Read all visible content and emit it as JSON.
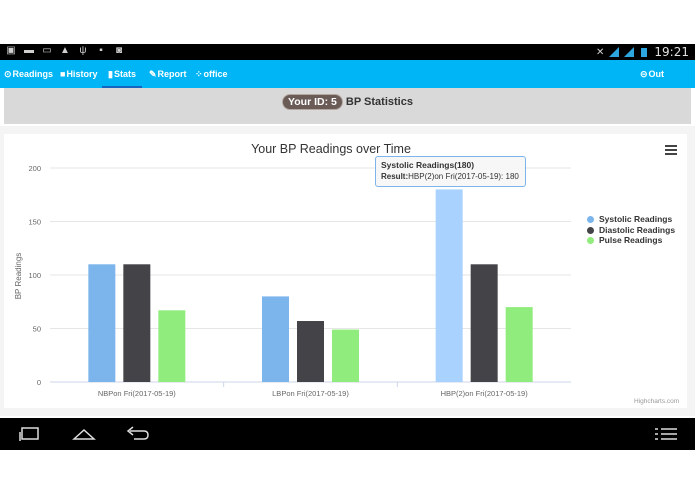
{
  "status": {
    "time": "19:21"
  },
  "nav": {
    "readings": "Readings",
    "history": "History",
    "stats": "Stats",
    "report": "Report",
    "office": "office",
    "out": "Out"
  },
  "header": {
    "id_label": "Your ID: 5",
    "title": "BP Statistics"
  },
  "chart_data": {
    "type": "bar",
    "title": "Your BP Readings over Time",
    "ylabel": "BP Readings",
    "xlabel": "",
    "ylim": [
      0,
      200
    ],
    "yticks": [
      "0",
      "50",
      "100",
      "150",
      "200"
    ],
    "categories": [
      "NBPon Fri(2017-05-19)",
      "LBPon Fri(2017-05-19)",
      "HBP(2)on Fri(2017-05-19)"
    ],
    "series": [
      {
        "name": "Systolic Readings",
        "color": "#7cb5ec",
        "values": [
          110,
          80,
          180
        ]
      },
      {
        "name": "Diastolic Readings",
        "color": "#434348",
        "values": [
          110,
          57,
          110
        ]
      },
      {
        "name": "Pulse Readings",
        "color": "#90ed7d",
        "values": [
          67,
          49,
          70
        ]
      }
    ],
    "legend": "right",
    "grid": true
  },
  "tooltip": {
    "title": "Systolic Readings(180)",
    "result_label": "Result:",
    "result_text": "HBP(2)on Fri(2017-05-19): 180"
  },
  "credits": "Highcharts.com"
}
